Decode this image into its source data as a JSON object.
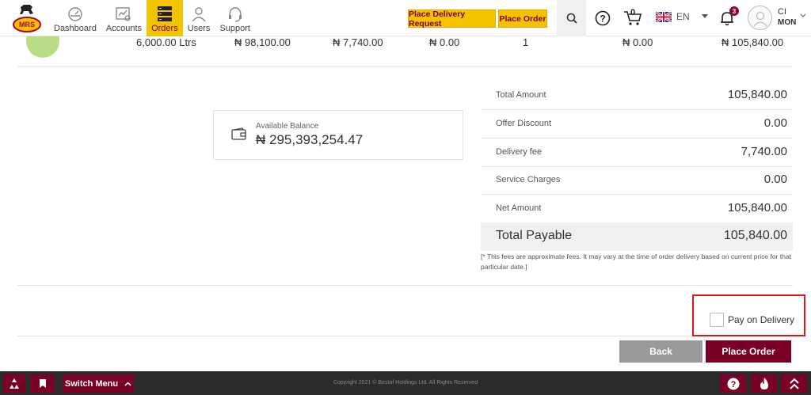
{
  "header": {
    "logo_text": "MRS",
    "nav": [
      {
        "label": "Dashboard",
        "icon": "dashboard-icon"
      },
      {
        "label": "Accounts",
        "icon": "accounts-icon"
      },
      {
        "label": "Orders",
        "icon": "orders-icon",
        "active": true
      },
      {
        "label": "Users",
        "icon": "users-icon"
      },
      {
        "label": "Support",
        "icon": "support-icon"
      }
    ],
    "place_delivery_request": "Place Delivery Request",
    "place_order": "Place Order",
    "cart_count": "0",
    "language": "EN",
    "notification_count": "3",
    "user_line1": "CI",
    "user_line2": "MON"
  },
  "order_row": {
    "quantity": "6,000.00 Ltrs",
    "amount": "₦ 98,100.00",
    "delivery": "₦ 7,740.00",
    "discount": "₦ 0.00",
    "count": "1",
    "charges": "₦ 0.00",
    "total": "₦ 105,840.00"
  },
  "balance": {
    "label": "Available Balance",
    "value": "₦ 295,393,254.47"
  },
  "summary": [
    {
      "label": "Total Amount",
      "value": "105,840.00"
    },
    {
      "label": "Offer Discount",
      "value": "0.00"
    },
    {
      "label": "Delivery fee",
      "value": "7,740.00"
    },
    {
      "label": "Service Charges",
      "value": "0.00"
    },
    {
      "label": "Net Amount",
      "value": "105,840.00"
    }
  ],
  "total_payable": {
    "label": "Total Payable",
    "value": "105,840.00"
  },
  "note": "[* This fees are approximate fees. It may vary at the time of order delivery based on current price for that particular date.]",
  "pay_on_delivery": "Pay on Delivery",
  "buttons": {
    "back": "Back",
    "place_order": "Place Order"
  },
  "footer": {
    "switch_menu": "Switch Menu",
    "copyright": "Copyright 2021 © Bestaf Holdings Ltd. All Rights Reserved"
  },
  "colors": {
    "brand": "#7a0026",
    "accent": "#f5c200",
    "highlight": "#e31515"
  }
}
